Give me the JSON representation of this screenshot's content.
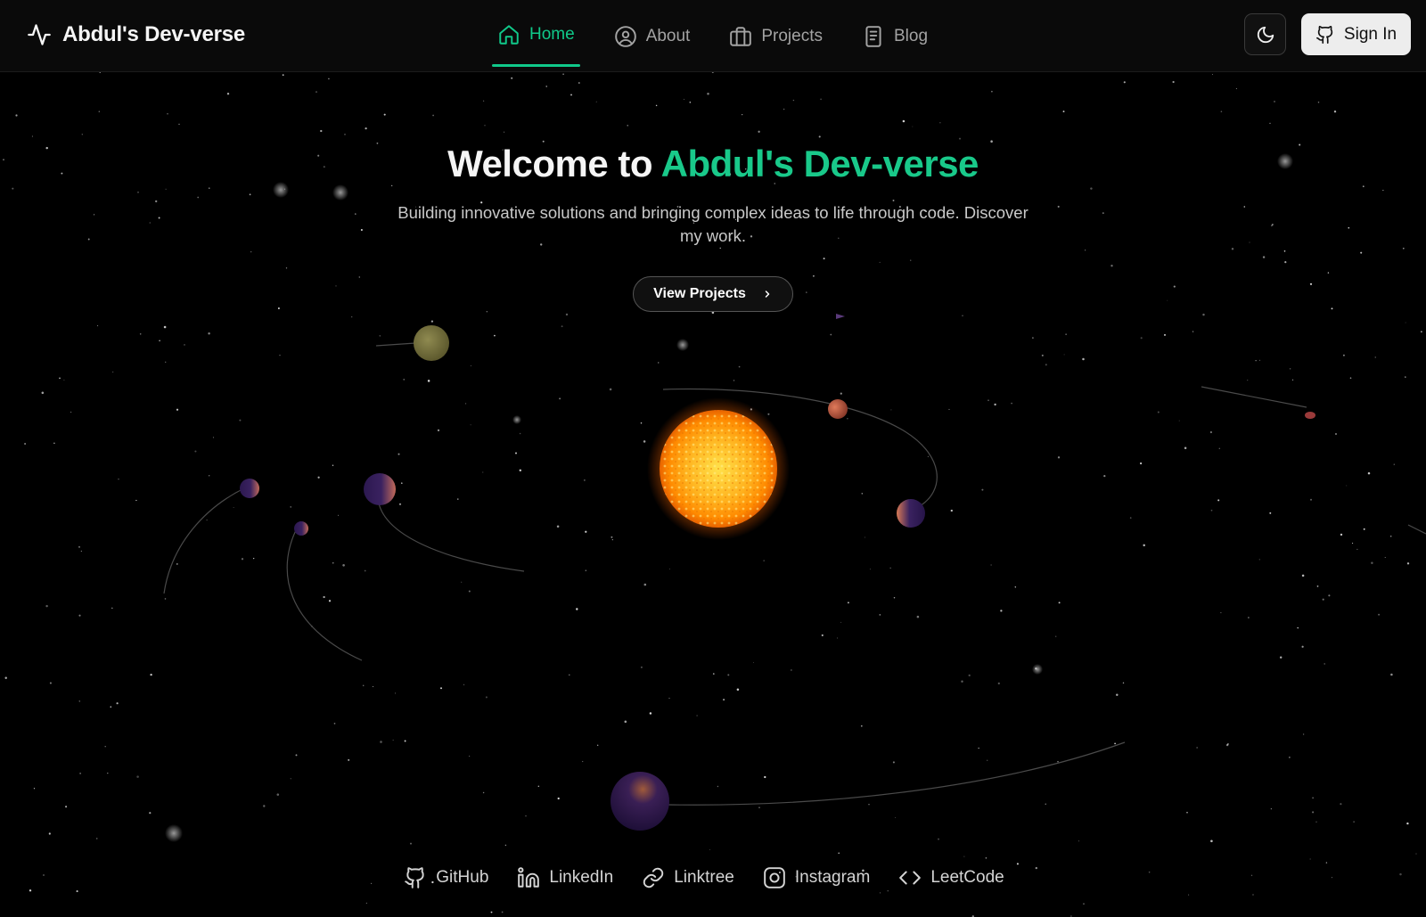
{
  "header": {
    "brand": "Abdul's Dev-verse",
    "brand_icon": "activity-pulse-icon",
    "nav": [
      {
        "label": "Home",
        "icon": "home-icon",
        "active": true
      },
      {
        "label": "About",
        "icon": "user-circle-icon",
        "active": false
      },
      {
        "label": "Projects",
        "icon": "briefcase-icon",
        "active": false
      },
      {
        "label": "Blog",
        "icon": "notebook-icon",
        "active": false
      }
    ],
    "theme_toggle_icon": "moon-icon",
    "sign_in_label": "Sign In",
    "sign_in_icon": "github-icon"
  },
  "hero": {
    "title_prefix": "Welcome to ",
    "title_accent": "Abdul's Dev-verse",
    "subtitle": "Building innovative solutions and bringing complex ideas to life through code. Discover my work.",
    "cta_label": "View Projects",
    "cta_icon": "chevron-right-icon"
  },
  "social": [
    {
      "label": "GitHub",
      "icon": "github-icon"
    },
    {
      "label": "LinkedIn",
      "icon": "linkedin-icon"
    },
    {
      "label": "Linktree",
      "icon": "link-icon"
    },
    {
      "label": "Instagram",
      "icon": "instagram-icon"
    },
    {
      "label": "LeetCode",
      "icon": "code-icon"
    }
  ],
  "colors": {
    "accent": "#19c98a",
    "background": "#000000",
    "header_bg": "#0a0a0a",
    "sun": "#ffb020"
  }
}
